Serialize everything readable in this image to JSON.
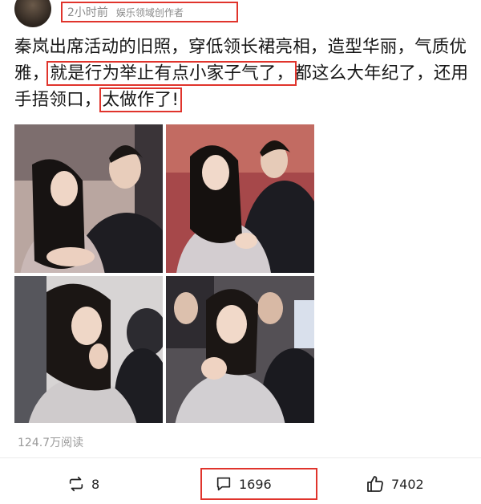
{
  "post": {
    "time": "2小时前",
    "author_tag": "娱乐领域创作者",
    "text": {
      "part1": "秦岚出席活动的旧照，穿低领长裙亮相，造型华丽，气质优雅，",
      "highlight1": "就是行为举止有点小家子气了，",
      "part2": "都这么大年纪了，还用手捂领口，",
      "highlight2": "太做作了!"
    },
    "reads": "124.7万阅读"
  },
  "actions": {
    "repost": {
      "icon": "repost-icon",
      "count": "8"
    },
    "comment": {
      "icon": "comment-icon",
      "count": "1696"
    },
    "like": {
      "icon": "thumbs-up-icon",
      "count": "7402"
    }
  },
  "colors": {
    "highlight_border": "#e0342c",
    "meta_text": "#8a8a8a"
  }
}
